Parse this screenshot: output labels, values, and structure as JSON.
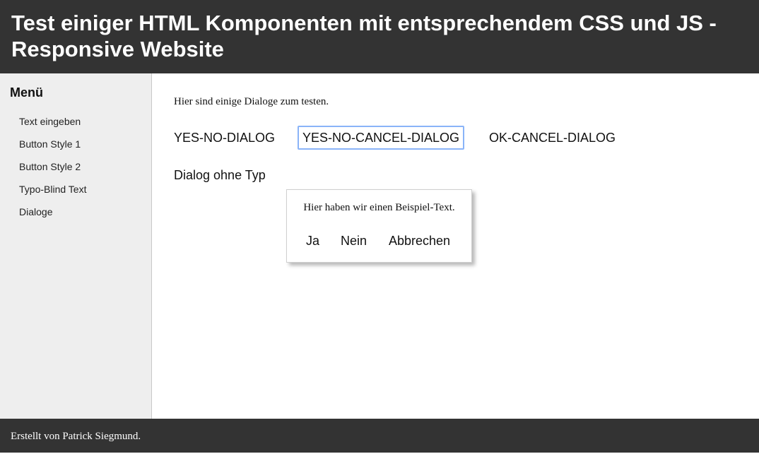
{
  "header": {
    "title": "Test einiger HTML Komponenten mit entsprechendem CSS und JS - Responsive Website"
  },
  "sidebar": {
    "title": "Menü",
    "items": [
      {
        "label": "Text eingeben"
      },
      {
        "label": "Button Style 1"
      },
      {
        "label": "Button Style 2"
      },
      {
        "label": "Typo-Blind Text"
      },
      {
        "label": "Dialoge"
      }
    ]
  },
  "main": {
    "intro": "Hier sind einige Dialoge zum testen.",
    "buttons": {
      "yes_no": "YES-NO-DIALOG",
      "yes_no_cancel": "YES-NO-CANCEL-DIALOG",
      "ok_cancel": "OK-CANCEL-DIALOG",
      "no_type": "Dialog ohne Typ"
    },
    "dialog": {
      "message": "Hier haben wir einen Beispiel-Text.",
      "yes": "Ja",
      "no": "Nein",
      "cancel": "Abbrechen"
    }
  },
  "footer": {
    "text": "Erstellt von Patrick Siegmund."
  }
}
